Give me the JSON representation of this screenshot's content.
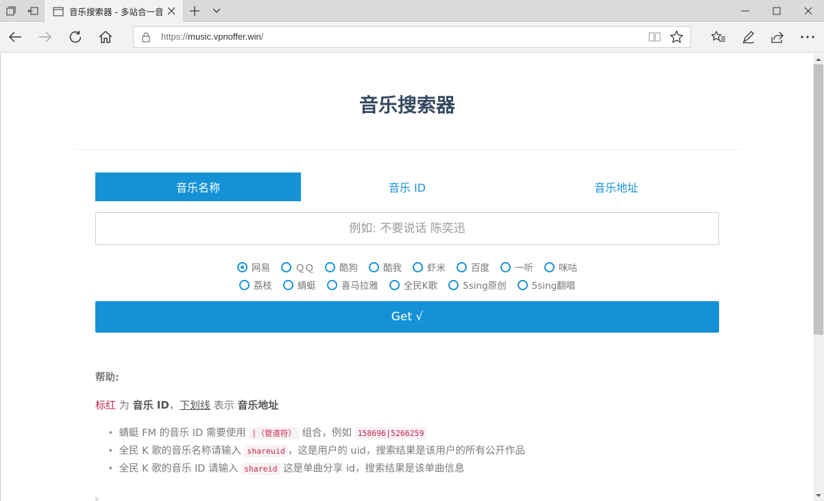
{
  "browser": {
    "tab_title": "音乐搜索器 - 多站合一音",
    "url_prefix": "https://",
    "url_host": "music.vpnoffer.win",
    "url_suffix": "/"
  },
  "page": {
    "title": "音乐搜索器",
    "tabs": [
      {
        "label": "音乐名称",
        "active": true
      },
      {
        "label": "音乐 ID",
        "active": false
      },
      {
        "label": "音乐地址",
        "active": false
      }
    ],
    "search_placeholder": "例如: 不要说话 陈奕迅",
    "sources_row1": [
      {
        "label": "网易",
        "selected": true
      },
      {
        "label": "ＱＱ",
        "selected": false
      },
      {
        "label": "酷狗",
        "selected": false
      },
      {
        "label": "酷我",
        "selected": false
      },
      {
        "label": "虾米",
        "selected": false
      },
      {
        "label": "百度",
        "selected": false
      },
      {
        "label": "一听",
        "selected": false
      },
      {
        "label": "咪咕",
        "selected": false
      }
    ],
    "sources_row2": [
      {
        "label": "荔枝",
        "selected": false
      },
      {
        "label": "蜻蜓",
        "selected": false
      },
      {
        "label": "喜马拉雅",
        "selected": false
      },
      {
        "label": "全民K歌",
        "selected": false
      },
      {
        "label": "5sing原创",
        "selected": false
      },
      {
        "label": "5sing翻唱",
        "selected": false
      }
    ],
    "get_button": "Get √",
    "help": {
      "title": "帮助:",
      "legend": {
        "red_text": "标红",
        "text1": " 为 ",
        "bold1": "音乐 ID",
        "sep": "，",
        "underline_text": "下划线",
        "text2": " 表示 ",
        "bold2": "音乐地址"
      },
      "items": [
        {
          "pre": "蜻蜓 FM 的音乐 ID 需要使用 ",
          "code1": "|（管道符）",
          "mid": " 组合，例如 ",
          "code2": "158696|5266259",
          "post": ""
        },
        {
          "pre": "全民 K 歌的音乐名称请输入 ",
          "code1": "shareuid",
          "mid": "，这是用户的 uid，搜索结果是该用户的所有公开作品",
          "code2": "",
          "post": ""
        },
        {
          "pre": "全民 K 歌的音乐 ID 请输入 ",
          "code1": "shareid",
          "mid": " 这是单曲分享 id，搜索结果是该单曲信息",
          "code2": "",
          "post": ""
        }
      ]
    }
  },
  "colors": {
    "accent": "#1592d6",
    "title": "#34495e",
    "code_red": "#c7254e"
  }
}
